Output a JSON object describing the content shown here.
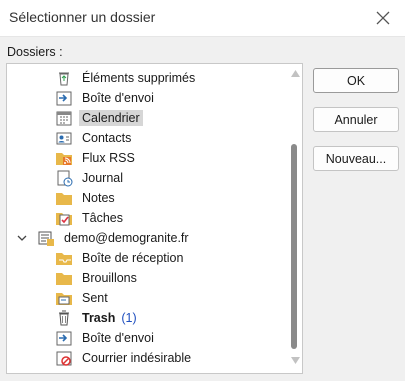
{
  "window": {
    "title": "Sélectionner un dossier"
  },
  "tree_label": "Dossiers :",
  "folders": [
    {
      "label": "Éléments supprimés",
      "icon": "recycle-bin-icon"
    },
    {
      "label": "Boîte d'envoi",
      "icon": "outbox-icon"
    },
    {
      "label": "Calendrier",
      "icon": "calendar-icon",
      "selected": true
    },
    {
      "label": "Contacts",
      "icon": "contacts-icon"
    },
    {
      "label": "Flux RSS",
      "icon": "rss-folder-icon"
    },
    {
      "label": "Journal",
      "icon": "journal-icon"
    },
    {
      "label": "Notes",
      "icon": "notes-folder-icon"
    },
    {
      "label": "Tâches",
      "icon": "tasks-icon"
    },
    {
      "label": "demo@demogranite.fr",
      "icon": "account-icon",
      "account": true,
      "expanded": true
    },
    {
      "label": "Boîte de réception",
      "icon": "inbox-folder-icon"
    },
    {
      "label": "Brouillons",
      "icon": "folder-icon"
    },
    {
      "label": "Sent",
      "icon": "sent-icon"
    },
    {
      "label": "Trash",
      "icon": "trash-icon",
      "bold": true,
      "count": "(1)"
    },
    {
      "label": "Boîte d'envoi",
      "icon": "outbox-icon"
    },
    {
      "label": "Courrier indésirable",
      "icon": "junk-icon"
    }
  ],
  "buttons": {
    "ok": "OK",
    "cancel": "Annuler",
    "new": "Nouveau..."
  },
  "colors": {
    "folder": "#e8b84a",
    "selection": "#d6d6d6",
    "count": "#1f4fbf",
    "accent": "#2b6cb0"
  }
}
